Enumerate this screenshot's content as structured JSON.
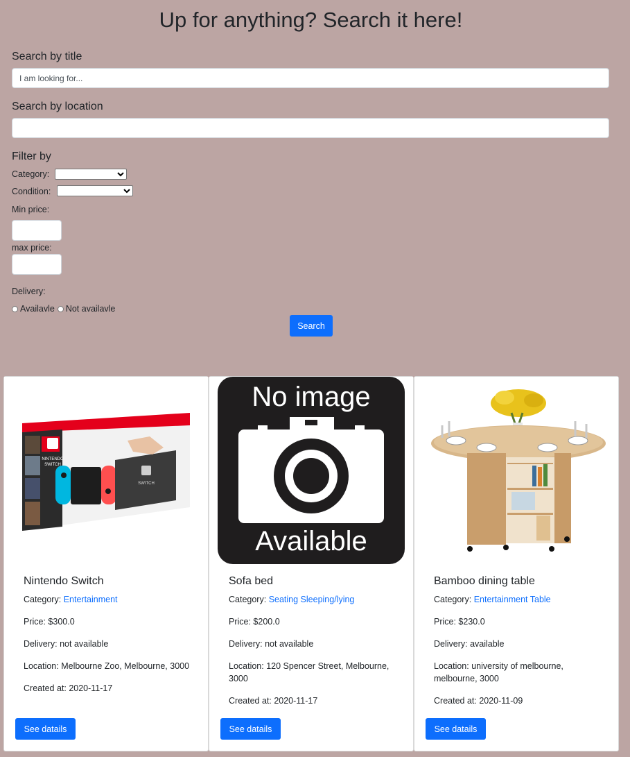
{
  "header": {
    "title": "Up for anything? Search it here!"
  },
  "search": {
    "title_label": "Search by title",
    "title_placeholder": "I am looking for...",
    "title_value": "",
    "location_label": "Search by location",
    "location_value": ""
  },
  "filters": {
    "heading": "Filter by",
    "category_label": "Category:",
    "category_value": "",
    "condition_label": "Condition:",
    "condition_value": "",
    "min_price_label": "Min price:",
    "max_price_label": "max price:",
    "delivery_label": "Delivery:",
    "delivery_options": [
      "Availavle",
      "Not availavle"
    ]
  },
  "search_button": "Search",
  "no_image_text": {
    "top": "No image",
    "bottom": "Available"
  },
  "listings": [
    {
      "title": "Nintendo Switch",
      "category_label": "Category:",
      "category": "Entertainment",
      "price": "Price: $300.0",
      "delivery": "Delivery: not available",
      "location": "Location: Melbourne Zoo, Melbourne, 3000",
      "created": "Created at: 2020-11-17",
      "button": "See datails",
      "image": "nintendo-switch-box"
    },
    {
      "title": "Sofa bed",
      "category_label": "Category:",
      "category": "Seating Sleeping/lying",
      "price": "Price: $200.0",
      "delivery": "Delivery: not available",
      "location": "Location: 120 Spencer Street, Melbourne, 3000",
      "created": "Created at: 2020-11-17",
      "button": "See datails",
      "image": "no-image-available"
    },
    {
      "title": "Bamboo dining table",
      "category_label": "Category:",
      "category": "Entertainment Table",
      "price": "Price: $230.0",
      "delivery": "Delivery: available",
      "location": "Location: university of melbourne, melbourne, 3000",
      "created": "Created at: 2020-11-09",
      "button": "See datails",
      "image": "bamboo-dining-table"
    }
  ],
  "colors": {
    "background": "#bca5a3",
    "accent": "#0d6efd",
    "card": "#ffffff"
  }
}
